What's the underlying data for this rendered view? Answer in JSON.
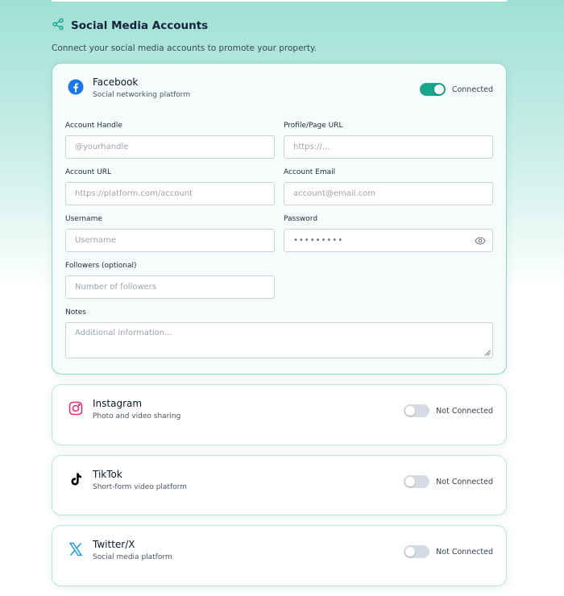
{
  "section": {
    "title": "Social Media Accounts",
    "description": "Connect your social media accounts to promote your property."
  },
  "facebook": {
    "name": "Facebook",
    "subtitle": "Social networking platform",
    "status": "Connected",
    "fields": {
      "account_handle_label": "Account Handle",
      "account_handle_placeholder": "@yourhandle",
      "profile_url_label": "Profile/Page URL",
      "profile_url_placeholder": "https://...",
      "account_url_label": "Account URL",
      "account_url_placeholder": "https://platform.com/account",
      "account_email_label": "Account Email",
      "account_email_placeholder": "account@email.com",
      "username_label": "Username",
      "username_placeholder": "Username",
      "password_label": "Password",
      "password_value": "•••••••••",
      "followers_label": "Followers (optional)",
      "followers_placeholder": "Number of followers",
      "notes_label": "Notes",
      "notes_placeholder": "Additional information..."
    }
  },
  "instagram": {
    "name": "Instagram",
    "subtitle": "Photo and video sharing",
    "status": "Not Connected"
  },
  "tiktok": {
    "name": "TikTok",
    "subtitle": "Short-form video platform",
    "status": "Not Connected"
  },
  "twitter": {
    "name": "Twitter/X",
    "subtitle": "Social media platform",
    "status": "Not Connected"
  },
  "colors": {
    "accent": "#17a58d",
    "facebook": "#1877f2",
    "instagram": "#e1306c",
    "twitter": "#1d9bf0"
  },
  "icons": [
    "share-icon",
    "facebook-icon",
    "instagram-icon",
    "tiktok-icon",
    "twitter-x-icon",
    "eye-icon"
  ]
}
